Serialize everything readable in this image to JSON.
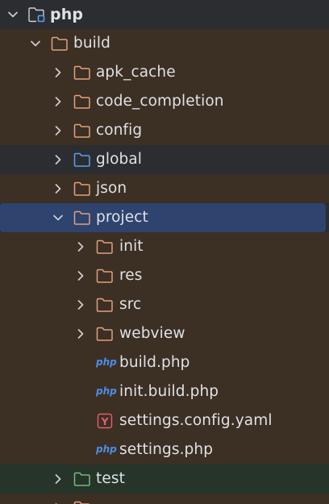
{
  "tree": {
    "root": {
      "label": "php"
    },
    "build": {
      "label": "build"
    },
    "apk_cache": {
      "label": "apk_cache"
    },
    "code_completion": {
      "label": "code_completion"
    },
    "config": {
      "label": "config"
    },
    "global": {
      "label": "global"
    },
    "json": {
      "label": "json"
    },
    "project": {
      "label": "project"
    },
    "init": {
      "label": "init"
    },
    "res": {
      "label": "res"
    },
    "src": {
      "label": "src"
    },
    "webview": {
      "label": "webview"
    },
    "build_php": {
      "label": "build.php",
      "badge": "php"
    },
    "init_build_php": {
      "label": "init.build.php",
      "badge": "php"
    },
    "settings_config_yaml": {
      "label": "settings.config.yaml",
      "badge": "Y"
    },
    "settings_php": {
      "label": "settings.php",
      "badge": "php"
    },
    "test": {
      "label": "test"
    }
  },
  "colors": {
    "folder_orange": "#e0a17c",
    "folder_blue": "#5e9ef0",
    "folder_green": "#79b87e",
    "text": "#dfe1e5",
    "php_badge": "#4c8fe6",
    "yaml_badge": "#e0606e"
  },
  "icons": {
    "expanded": "chevron-down-icon",
    "collapsed": "chevron-right-icon",
    "folder": "folder-icon",
    "module": "module-folder-icon",
    "php_file": "php-file-icon",
    "yaml_file": "yaml-file-icon"
  }
}
